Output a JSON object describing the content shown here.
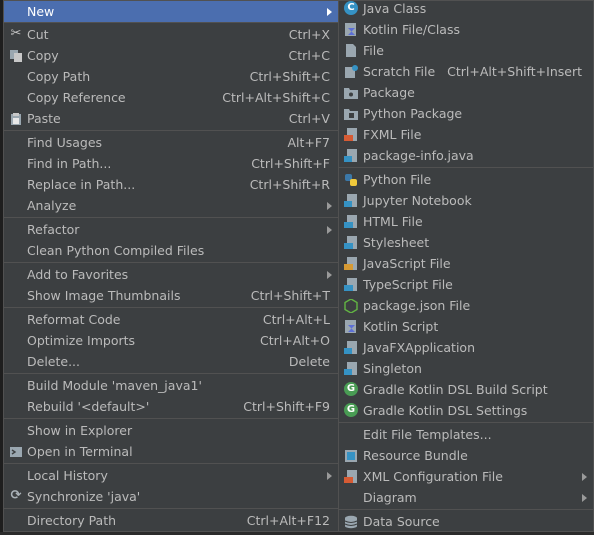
{
  "colors": {
    "menu_bg": "#3c3f41",
    "highlight": "#4b6eaf",
    "text": "#bbbbbb",
    "separator": "#515151"
  },
  "context_menu": {
    "new": "New",
    "cut": "Cut",
    "cut_sc": "Ctrl+X",
    "copy": "Copy",
    "copy_sc": "Ctrl+C",
    "copy_path": "Copy Path",
    "copy_path_sc": "Ctrl+Shift+C",
    "copy_reference": "Copy Reference",
    "copy_reference_sc": "Ctrl+Alt+Shift+C",
    "paste": "Paste",
    "paste_sc": "Ctrl+V",
    "find_usages": "Find Usages",
    "find_usages_sc": "Alt+F7",
    "find_in_path": "Find in Path...",
    "find_in_path_sc": "Ctrl+Shift+F",
    "replace_in_path": "Replace in Path...",
    "replace_in_path_sc": "Ctrl+Shift+R",
    "analyze": "Analyze",
    "refactor": "Refactor",
    "clean_python": "Clean Python Compiled Files",
    "add_favorites": "Add to Favorites",
    "show_thumbnails": "Show Image Thumbnails",
    "show_thumbnails_sc": "Ctrl+Shift+T",
    "reformat_code": "Reformat Code",
    "reformat_code_sc": "Ctrl+Alt+L",
    "optimize_imports": "Optimize Imports",
    "optimize_imports_sc": "Ctrl+Alt+O",
    "delete": "Delete...",
    "delete_sc": "Delete",
    "build_module": "Build Module 'maven_java1'",
    "rebuild": "Rebuild '<default>'",
    "rebuild_sc": "Ctrl+Shift+F9",
    "show_explorer": "Show in Explorer",
    "open_terminal": "Open in Terminal",
    "local_history": "Local History",
    "synchronize": "Synchronize 'java'",
    "directory_path": "Directory Path",
    "directory_path_sc": "Ctrl+Alt+F12"
  },
  "new_submenu": {
    "java_class": "Java Class",
    "kotlin_file": "Kotlin File/Class",
    "file": "File",
    "scratch_file": "Scratch File",
    "scratch_file_sc": "Ctrl+Alt+Shift+Insert",
    "package": "Package",
    "python_package": "Python Package",
    "fxml_file": "FXML File",
    "package_info": "package-info.java",
    "python_file": "Python File",
    "jupyter_notebook": "Jupyter Notebook",
    "html_file": "HTML File",
    "stylesheet": "Stylesheet",
    "javascript_file": "JavaScript File",
    "typescript_file": "TypeScript File",
    "package_json": "package.json File",
    "kotlin_script": "Kotlin Script",
    "javafx_app": "JavaFXApplication",
    "singleton": "Singleton",
    "gradle_build": "Gradle Kotlin DSL Build Script",
    "gradle_settings": "Gradle Kotlin DSL Settings",
    "edit_templates": "Edit File Templates...",
    "resource_bundle": "Resource Bundle",
    "xml_config": "XML Configuration File",
    "diagram": "Diagram",
    "data_source": "Data Source"
  }
}
